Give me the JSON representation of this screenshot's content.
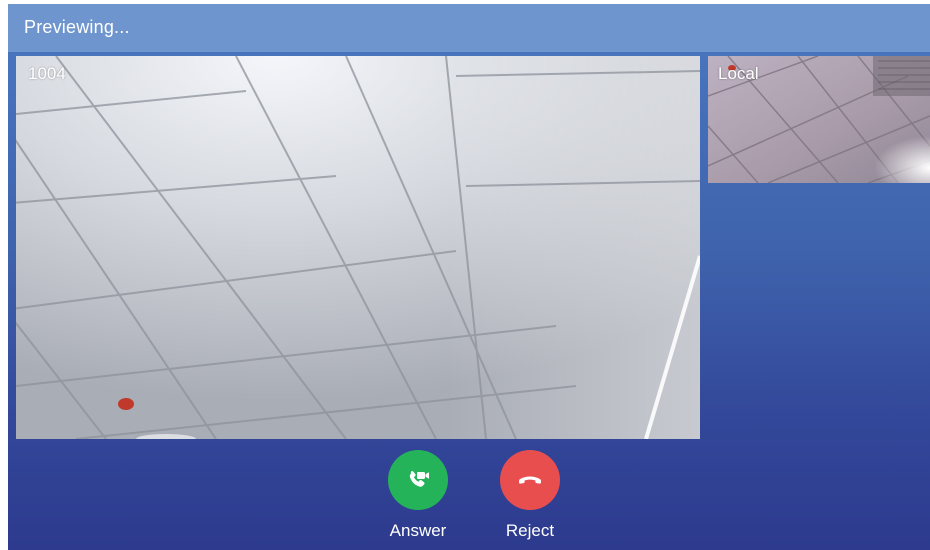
{
  "status_bar": {
    "text": "Previewing..."
  },
  "remote_video": {
    "label": "1004"
  },
  "local_video": {
    "label": "Local"
  },
  "actions": {
    "answer": {
      "label": "Answer",
      "icon": "video-call-answer-icon",
      "color": "#25b35a"
    },
    "reject": {
      "label": "Reject",
      "icon": "hang-up-icon",
      "color": "#e94e4e"
    }
  },
  "colors": {
    "status_bar": "#6f95cf",
    "background_top": "#4a78c2",
    "background_bottom": "#2d3a8e"
  }
}
